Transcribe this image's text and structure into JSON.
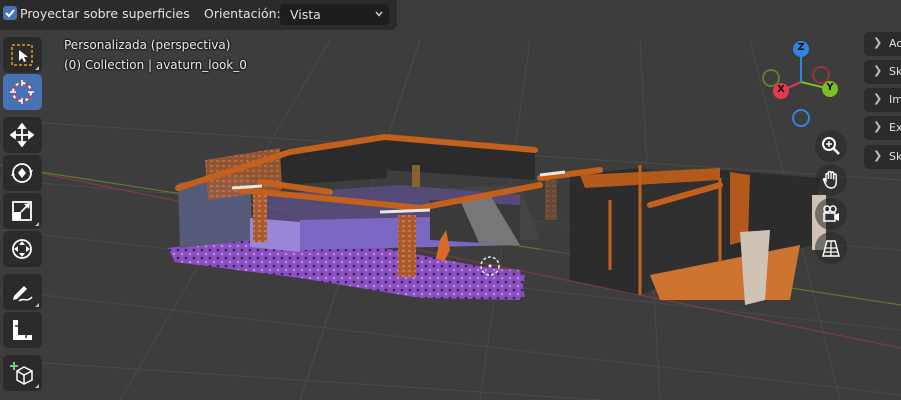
{
  "header": {
    "snap_checkbox_label": "Proyectar sobre superficies",
    "orientation_label": "Orientación:",
    "orientation_value": "Vista"
  },
  "overlay": {
    "view_name": "Personalizada (perspectiva)",
    "collection_info": "(0) Collection | avaturn_look_0"
  },
  "toolbar": {
    "tools": [
      "select",
      "cursor",
      "move",
      "rotate",
      "scale",
      "transform",
      "annotate",
      "measure",
      "add-cube"
    ],
    "active_tool": "cursor"
  },
  "gizmo": {
    "x_label": "X",
    "y_label": "Y",
    "z_label": "Z",
    "colors": {
      "x": "#e8384f",
      "y": "#7bbf24",
      "z": "#2f85e6"
    }
  },
  "right_tabs": [
    {
      "label": "Ac"
    },
    {
      "label": "Sk"
    },
    {
      "label": "Im"
    },
    {
      "label": "Ex"
    },
    {
      "label": "Sk"
    }
  ],
  "colors": {
    "viewport_bg": "#3d3d3d",
    "accent": "#4772b3",
    "panel": "#2b2b2b"
  }
}
